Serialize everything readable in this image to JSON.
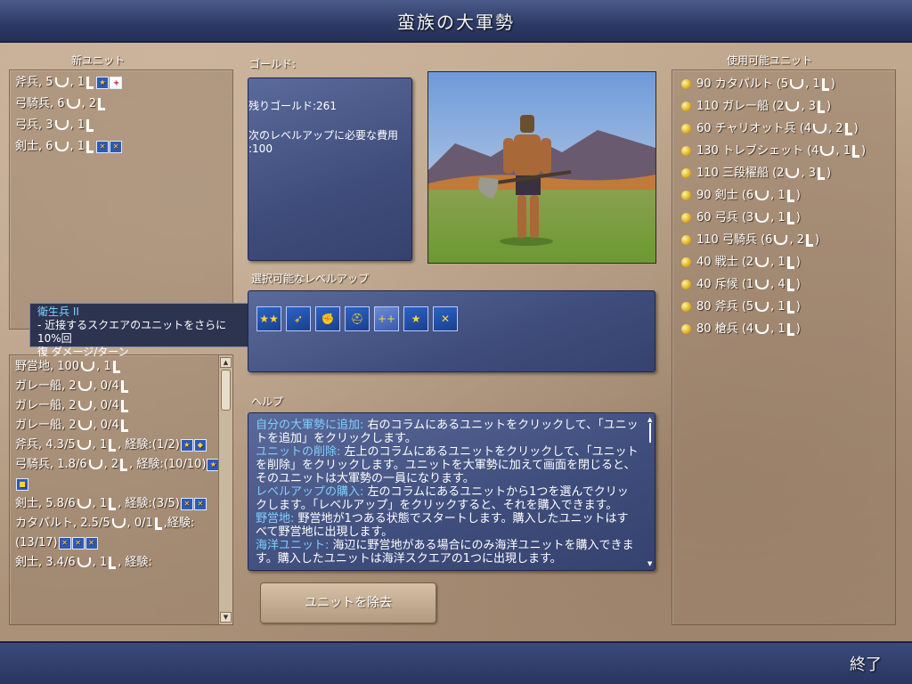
{
  "title": "蛮族の大軍勢",
  "end_label": "終了",
  "left": {
    "new_units_label": "新ユニット",
    "new_units": [
      {
        "text": "斧兵, 5",
        "mid": ", 1",
        "promos": [
          "★",
          "+"
        ]
      },
      {
        "text": "弓騎兵, 6",
        "mid": ", 2",
        "promos": []
      },
      {
        "text": "弓兵, 3",
        "mid": ", 1",
        "promos": []
      },
      {
        "text": "剣士, 6",
        "mid": ", 1",
        "promos": [
          "✕",
          "✕"
        ]
      }
    ],
    "army": [
      {
        "lines": [
          "野営地, 100",
          ", 1"
        ]
      },
      {
        "lines": [
          "ガレー船, 2",
          ", 0/4"
        ]
      },
      {
        "lines": [
          "ガレー船, 2",
          ", 0/4"
        ]
      },
      {
        "lines": [
          "ガレー船, 2",
          ", 0/4"
        ]
      },
      {
        "lines": [
          "斧兵, 4.3/5",
          ", 1",
          ", 経験:",
          "(1/2)"
        ],
        "promos": [
          "★",
          "◆"
        ]
      },
      {
        "lines": [
          "弓騎兵, 1.8/6",
          ", 2",
          ", 経験:",
          "(10/10)"
        ],
        "promos": [
          "★",
          "■"
        ]
      },
      {
        "lines": [
          "剣士, 5.8/6",
          ", 1",
          ", 経験:",
          "(3/5)"
        ],
        "promos": [
          "✕",
          "✕"
        ]
      },
      {
        "lines": [
          "カタパルト, 2.5/5",
          ", 0/1",
          ",",
          "経験: (13/17)"
        ],
        "promos": [
          "✕",
          "✕",
          "✕"
        ]
      },
      {
        "lines": [
          "剣士, 3.4/6",
          ", 1",
          ", 経験:"
        ],
        "promos": []
      }
    ]
  },
  "tooltip": {
    "title": "衛生兵 II",
    "line1": "- 近接するスクエアのユニットをさらに10%回",
    "line2": "復 ダメージ/ターン"
  },
  "center": {
    "gold_label": "ゴールド:",
    "gold_remaining": "残りゴールド:261",
    "levelup_cost_line1": "次のレベルアップに必要な費用",
    "levelup_cost_line2": ":100",
    "promos_label": "選択可能なレベルアップ",
    "promos": [
      "★★",
      "➶",
      "✊",
      "⛑",
      "++",
      "★",
      "✕"
    ],
    "help_label": "ヘルプ",
    "help": [
      {
        "hl": "自分の大軍勢に追加:",
        "txt": " 右のコラムにあるユニットをクリックして、「ユニットを追加」をクリックします。"
      },
      {
        "hl": "ユニットの削除:",
        "txt": " 左上のコラムにあるユニットをクリックして、「ユニットを削除」をクリックします。ユニットを大軍勢に加えて画面を閉じると、そのユニットは大軍勢の一員になります。"
      },
      {
        "hl": "レベルアップの購入:",
        "txt": " 左のコラムにあるユニットから1つを選んでクリックします。「レベルアップ」をクリックすると、それを購入できます。"
      },
      {
        "hl": "野営地:",
        "txt": " 野営地が1つある状態でスタートします。購入したユニットはすべて野営地に出現します。"
      },
      {
        "hl": "海洋ユニット:",
        "txt": " 海辺に野営地がある場合にのみ海洋ユニットを購入できます。購入したユニットは海洋スクエアの1つに出現します。"
      }
    ],
    "remove_button": "ユニットを除去"
  },
  "right": {
    "available_label": "使用可能ユニット",
    "units": [
      {
        "cost": "90",
        "name": "カタパルト (5",
        "mid": ", 1",
        "end": ")"
      },
      {
        "cost": "110",
        "name": "ガレー船 (2",
        "mid": ", 3",
        "end": ")"
      },
      {
        "cost": "60",
        "name": "チャリオット兵 (4",
        "mid": ", 2",
        "end": ")"
      },
      {
        "cost": "130",
        "name": "トレブシェット (4",
        "mid": ", 1",
        "end": ")"
      },
      {
        "cost": "110",
        "name": "三段櫂船 (2",
        "mid": ", 3",
        "end": ")"
      },
      {
        "cost": "90",
        "name": "剣士 (6",
        "mid": ", 1",
        "end": ")"
      },
      {
        "cost": "60",
        "name": "弓兵 (3",
        "mid": ", 1",
        "end": ")"
      },
      {
        "cost": "110",
        "name": "弓騎兵 (6",
        "mid": ", 2",
        "end": ")"
      },
      {
        "cost": "40",
        "name": "戦士 (2",
        "mid": ", 1",
        "end": ")"
      },
      {
        "cost": "40",
        "name": "斥候 (1",
        "mid": ", 4",
        "end": ")"
      },
      {
        "cost": "80",
        "name": "斧兵 (5",
        "mid": ", 1",
        "end": ")"
      },
      {
        "cost": "80",
        "name": "槍兵 (4",
        "mid": ", 1",
        "end": ")"
      }
    ]
  }
}
